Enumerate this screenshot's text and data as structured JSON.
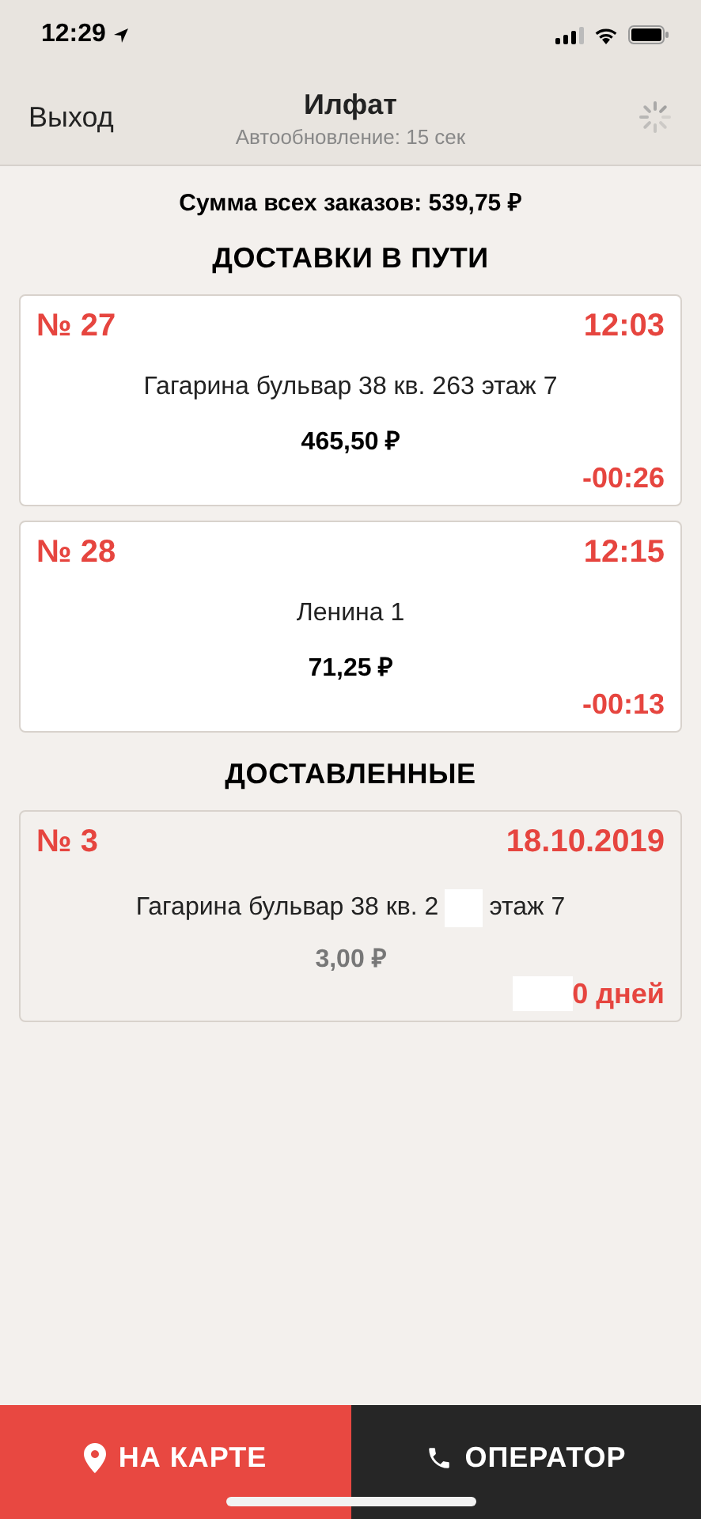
{
  "status_bar": {
    "time": "12:29"
  },
  "nav": {
    "back": "Выход",
    "title": "Илфат",
    "subtitle": "Автообновление: 15 сек"
  },
  "total": "Сумма всех заказов: 539,75 ₽",
  "sections": [
    {
      "title": "ДОСТАВКИ В ПУТИ",
      "kind": "in_transit",
      "orders": [
        {
          "number": "№ 27",
          "time": "12:03",
          "address": [
            "Гагарина бульвар 38 кв. 263 этаж 7"
          ],
          "price": "465,50 ₽",
          "elapsed": "-00:26",
          "elapsed_masked": false
        },
        {
          "number": "№ 28",
          "time": "12:15",
          "address": [
            "Ленина 1"
          ],
          "price": "71,25 ₽",
          "elapsed": "-00:13",
          "elapsed_masked": false
        }
      ]
    },
    {
      "title": "ДОСТАВЛЕННЫЕ",
      "kind": "delivered",
      "orders": [
        {
          "number": "№ 3",
          "time": "18.10.2019",
          "address": [
            "Гагарина бульвар 38 кв. 2",
            "этаж 7"
          ],
          "price": "3,00 ₽",
          "elapsed": "0 дней",
          "elapsed_masked": true
        }
      ]
    }
  ],
  "bottom_bar": {
    "map_button": "НА КАРТЕ",
    "operator_button": "ОПЕРАТОР"
  }
}
